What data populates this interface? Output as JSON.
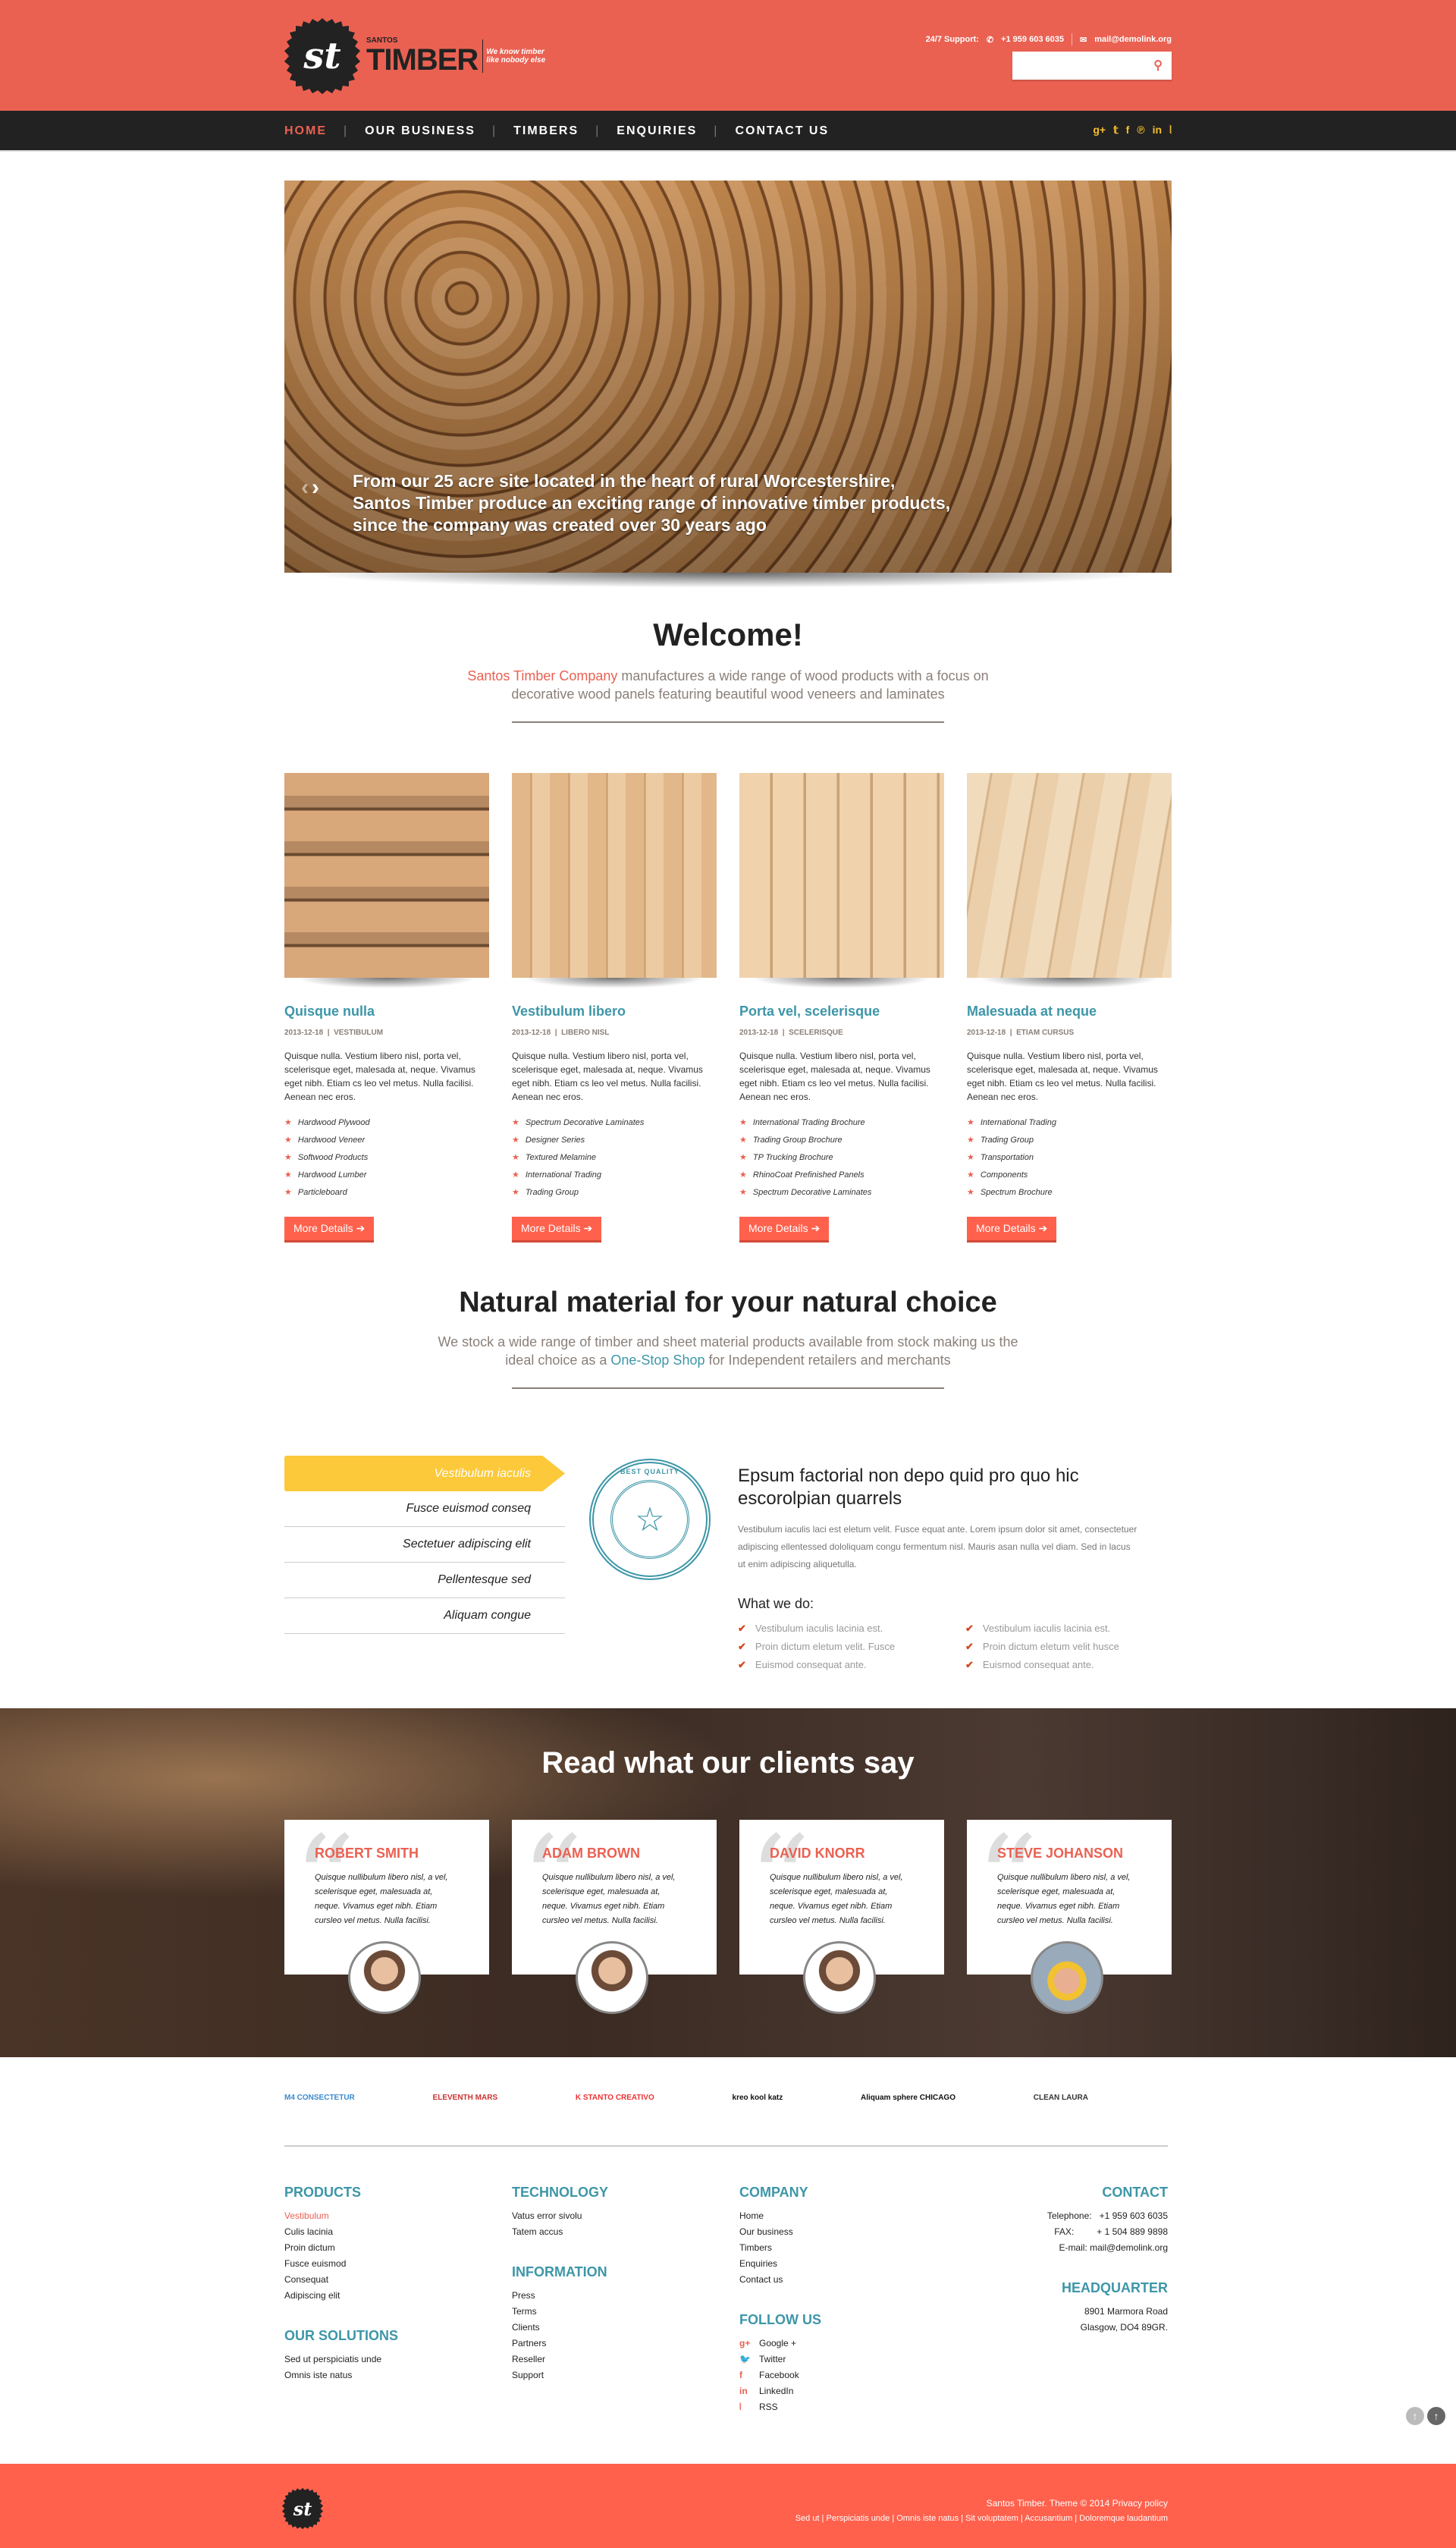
{
  "header": {
    "logo_initials": "st",
    "logo_small": "SANTOS",
    "logo_big": "TIMBER",
    "tagline_1": "We know timber",
    "tagline_2": "like nobody else",
    "support_label": "24/7 Support:",
    "phone": "+1 959 603 6035",
    "email": "mail@demolink.org",
    "search_placeholder": "",
    "search_icon": "search-icon"
  },
  "nav": {
    "items": [
      "HOME",
      "OUR BUSINESS",
      "TIMBERS",
      "ENQUIRIES",
      "CONTACT US"
    ],
    "active": "HOME",
    "social": [
      "google-plus-icon",
      "twitter-icon",
      "facebook-icon",
      "pinterest-icon",
      "linkedin-icon",
      "rss-icon"
    ]
  },
  "slider": {
    "caption_1": "From our 25 acre site located in the heart of rural Worcestershire,",
    "caption_2": "Santos Timber produce an exciting range of innovative timber products,",
    "caption_3": "since the company was created over 30 years ago"
  },
  "welcome": {
    "title": "Welcome!",
    "accent": "Santos Timber Company",
    "text": " manufactures a wide range of wood products with a focus on decorative wood panels featuring beautiful wood veneers and laminates"
  },
  "products": [
    {
      "title": "Quisque nulla",
      "date": "2013-12-18",
      "category": "VESTIBULUM",
      "text": "Quisque nulla. Vestium libero nisl, porta vel, scelerisque eget, malesada at, neque. Vivamus eget nibh. Etiam cs leo vel metus. Nulla facilisi. Aenean nec eros.",
      "list": [
        "Hardwood Plywood",
        "Hardwood Veneer",
        "Softwood Products",
        "Hardwood Lumber",
        "Particleboard"
      ],
      "button": "More Details"
    },
    {
      "title": "Vestibulum libero",
      "date": "2013-12-18",
      "category": "LIBERO NISL",
      "text": "Quisque nulla. Vestium libero nisl, porta vel, scelerisque eget, malesada at, neque. Vivamus eget nibh. Etiam cs leo vel metus. Nulla facilisi. Aenean nec eros.",
      "list": [
        "Spectrum Decorative Laminates",
        "Designer Series",
        "Textured Melamine",
        "International Trading",
        "Trading Group"
      ],
      "button": "More Details"
    },
    {
      "title": "Porta vel, scelerisque",
      "date": "2013-12-18",
      "category": "SCELERISQUE",
      "text": "Quisque nulla. Vestium libero nisl, porta vel, scelerisque eget, malesada at, neque. Vivamus eget nibh. Etiam cs leo vel metus. Nulla facilisi. Aenean nec eros.",
      "list": [
        "International Trading Brochure",
        "Trading Group Brochure",
        "TP Trucking Brochure",
        "RhinoCoat Prefinished Panels",
        "Spectrum Decorative Laminates"
      ],
      "button": "More Details"
    },
    {
      "title": "Malesuada at neque",
      "date": "2013-12-18",
      "category": "ETIAM CURSUS",
      "text": "Quisque nulla. Vestium libero nisl, porta vel, scelerisque eget, malesada at, neque. Vivamus eget nibh. Etiam cs leo vel metus. Nulla facilisi. Aenean nec eros.",
      "list": [
        "International Trading",
        "Trading Group",
        "Transportation",
        "Components",
        "Spectrum Brochure"
      ],
      "button": "More Details"
    }
  ],
  "natural": {
    "title": "Natural material for your natural choice",
    "text_1": "We stock a wide range of timber and sheet material products available from stock making us the ideal choice as a ",
    "link": "One-Stop Shop",
    "text_2": " for Independent retailers and merchants",
    "tabs": [
      "Vestibulum iaculis",
      "Fusce euismod conseq",
      "Sectetuer adipiscing elit",
      "Pellentesque sed",
      "Aliquam congue"
    ],
    "active_tab": "Vestibulum iaculis",
    "seal_text": "BEST QUALITY",
    "heading": "Epsum factorial non depo quid pro quo hic escorolpian quarrels",
    "paragraph": "Vestibulum iaculis laci est eletum velit. Fusce equat ante. Lorem ipsum dolor sit amet, consectetuer adipiscing ellentessed dololiquam congu fermentum nisl. Mauris asan nulla vel diam. Sed in lacus ut enim adipiscing aliquetulla.",
    "what_we_do": "What we do:",
    "checks": [
      "Vestibulum iaculis lacinia est.",
      "Vestibulum iaculis lacinia est.",
      "Proin dictum eletum velit. Fusce",
      "Proin dictum eletum velit husce",
      "Euismod consequat ante.",
      "Euismod consequat ante."
    ]
  },
  "testimonials": {
    "title": "Read what our clients say",
    "items": [
      {
        "name": "ROBERT SMITH",
        "text": "Quisque nullibulum libero nisl, a vel, scelerisque eget, malesuada at, neque. Vivamus eget nibh. Etiam cursleo vel metus. Nulla facilisi."
      },
      {
        "name": "ADAM BROWN",
        "text": "Quisque nullibulum libero nisl, a vel, scelerisque eget, malesuada at, neque. Vivamus eget nibh. Etiam cursleo vel metus. Nulla facilisi."
      },
      {
        "name": "DAVID KNORR",
        "text": "Quisque nullibulum libero nisl, a vel, scelerisque eget, malesuada at, neque. Vivamus eget nibh. Etiam cursleo vel metus. Nulla facilisi."
      },
      {
        "name": "STEVE JOHANSON",
        "text": "Quisque nullibulum libero nisl, a vel, scelerisque eget, malesuada at, neque. Vivamus eget nibh. Etiam cursleo vel metus. Nulla facilisi."
      }
    ]
  },
  "logos": [
    "M4 CONSECTETUR",
    "ELEVENTH MARS",
    "K STANTO CREATIVO",
    "kreo kool katz",
    "Aliquam sphere CHICAGO",
    "CLEAN LAURA"
  ],
  "footer": {
    "products": {
      "title": "PRODUCTS",
      "items": [
        "Vestibulum",
        "Culis lacinia",
        "Proin dictum",
        "Fusce euismod",
        "Consequat",
        "Adipiscing elit"
      ]
    },
    "solutions": {
      "title": "OUR SOLUTIONS",
      "items": [
        "Sed ut perspiciatis unde",
        "Omnis iste natus"
      ]
    },
    "technology": {
      "title": "TECHNOLOGY",
      "items": [
        "Vatus error sivolu",
        "Tatem accus"
      ]
    },
    "information": {
      "title": "INFORMATION",
      "items": [
        "Press",
        "Terms",
        "Clients",
        "Partners",
        "Reseller",
        "Support"
      ]
    },
    "company": {
      "title": "COMPANY",
      "items": [
        "Home",
        "Our business",
        "Timbers",
        "Enquiries",
        "Contact us"
      ]
    },
    "follow": {
      "title": "FOLLOW US",
      "items": [
        "Google +",
        "Twitter",
        "Facebook",
        "LinkedIn",
        "RSS"
      ]
    },
    "contact": {
      "title": "CONTACT",
      "telephone": "Telephone:   +1 959 603 6035",
      "fax": "FAX:         + 1 504 889 9898",
      "email": "E-mail: mail@demolink.org"
    },
    "hq": {
      "title": "HEADQUARTER",
      "line1": "8901 Marmora Road",
      "line2": "Glasgow, DO4 89GR."
    }
  },
  "bottom": {
    "copyright": "Santos Timber. Theme © 2014 Privacy policy",
    "links": [
      "Sed ut",
      "Perspiciatis unde",
      "Omnis iste natus",
      "Sit voluptatem",
      "Accusantium",
      "Doloremque laudantium"
    ]
  },
  "colors": {
    "accent": "#ea6152",
    "teal": "#3d96a8",
    "yellow": "#fcc93a",
    "dark": "#222222"
  }
}
